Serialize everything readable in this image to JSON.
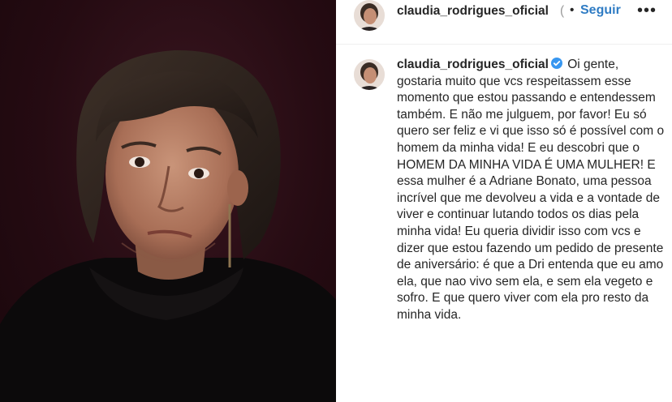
{
  "header": {
    "username": "claudia_rodrigues_oficial",
    "truncation_mark": "(",
    "separator": "•",
    "follow_label": "Seguir",
    "more_label": "•••"
  },
  "caption": {
    "username": "claudia_rodrigues_oficial",
    "text": "Oi gente, gostaria muito que vcs respeitassem esse momento que estou passando e entendessem também. E não me julguem, por favor! Eu só quero ser feliz e vi que isso só é possível com o homem da minha vida! E eu descobri que o HOMEM DA MINHA VIDA É UMA MULHER! E essa mulher é a Adriane Bonato, uma pessoa incrível que me devolveu a vida e a vontade de viver e continuar lutando todos os dias pela minha vida! Eu queria dividir isso com vcs e dizer que estou fazendo um pedido de presente de aniversário: é que a Dri entenda que eu amo ela, que nao vivo sem ela, e sem ela vegeto e sofro. E que quero viver com ela pro resto da minha vida."
  },
  "colors": {
    "link": "#2f7cc4",
    "verified": "#3897f0",
    "text": "#262626",
    "background_photo": "#250b12"
  },
  "icons": {
    "verified": "verified-badge-icon",
    "more": "more-options-icon"
  }
}
